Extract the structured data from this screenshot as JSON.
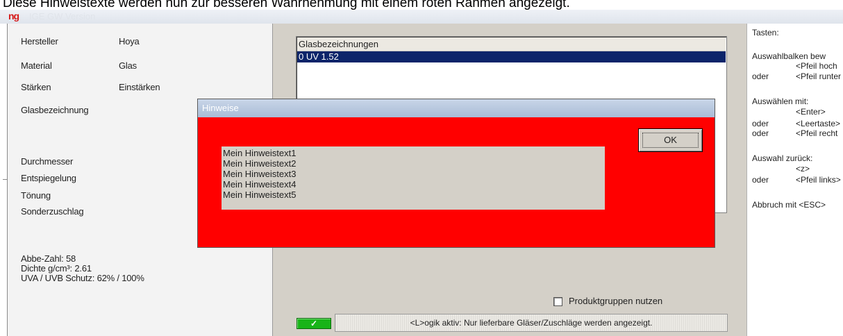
{
  "caption": "Diese Hinweistexte werden nun zur besseren Wahrnehmung mit einem roten Rahmen angezeigt.",
  "app": {
    "logo": "ng",
    "title": "IGE GW Version"
  },
  "left": {
    "rows": [
      {
        "label": "Hersteller",
        "value": "Hoya"
      },
      {
        "label": "Material",
        "value": "Glas"
      },
      {
        "label": "Stärken",
        "value": "Einstärken"
      }
    ],
    "glasbezeichnung": "Glasbezeichnung",
    "options": [
      "Durchmesser",
      "Entspiegelung",
      "Tönung",
      "Sonderzuschlag"
    ],
    "info": [
      "Abbe-Zahl: 58",
      "Dichte g/cm³: 2.61",
      "UVA / UVB Schutz: 62% / 100%"
    ]
  },
  "list": {
    "header": "Glasbezeichnungen",
    "selected": "0 UV 1.52"
  },
  "checkbox": {
    "label": "Produktgruppen nutzen",
    "checked": false
  },
  "status": {
    "indicator": "✓",
    "text": "<L>ogik aktiv: Nur lieferbare Gläser/Zuschläge werden angezeigt."
  },
  "help": {
    "title": "Tasten:",
    "l1": "Auswahlbalken bew",
    "l2": "<Pfeil hoch",
    "l3a": "oder",
    "l3b": "<Pfeil runter",
    "l4": "Auswählen mit:",
    "l5": "<Enter>",
    "l6a": "oder",
    "l6b": "<Leertaste>",
    "l7a": "oder",
    "l7b": "<Pfeil recht",
    "l8": "Auswahl zurück:",
    "l9": "<z>",
    "l10a": "oder",
    "l10b": "<Pfeil links>",
    "l11": "Abbruch mit <ESC>"
  },
  "dialog": {
    "title": "Hinweise",
    "ok": "OK",
    "lines": [
      "Mein Hinweistext1",
      "Mein Hinweistext2",
      "Mein Hinweistext3",
      "Mein Hinweistext4",
      "Mein Hinweistext5"
    ]
  },
  "colors": {
    "dialog_bg": "#ff0000",
    "selection": "#0c246a",
    "status_ok": "#18b418"
  }
}
